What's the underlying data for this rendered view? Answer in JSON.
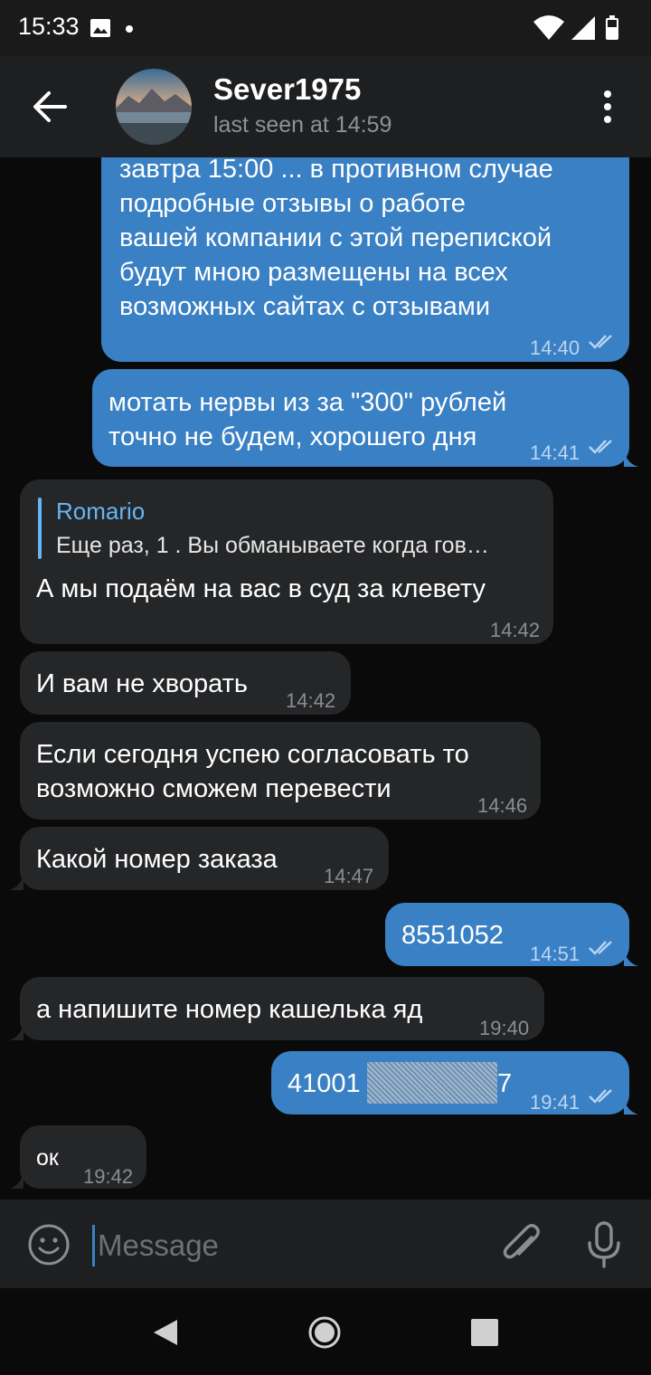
{
  "status_bar": {
    "time": "15:33",
    "icons": [
      "photo-icon",
      "dot-icon",
      "wifi-icon",
      "signal-icon",
      "battery-icon"
    ]
  },
  "header": {
    "title": "Sever1975",
    "subtitle": "last seen at 14:59",
    "icons": [
      "back-arrow-icon",
      "avatar",
      "more-vertical-icon"
    ]
  },
  "messages": [
    {
      "dir": "out",
      "lines": [
        "завтра 15:00 ... в противном случае",
        "подробные отзывы о работе",
        "вашей компании с этой перепиской",
        "будут мною размещены на всех",
        "возможных сайтах с отзывами"
      ],
      "time": "14:40",
      "read": true
    },
    {
      "dir": "out",
      "lines": [
        "мотать нервы из за \"300\" рублей",
        "точно не будем, хорошего дня"
      ],
      "time": "14:41",
      "read": true
    },
    {
      "dir": "in",
      "reply_name": "Romario",
      "reply_text": "Еще раз, 1 . Вы обманываете когда гов…",
      "lines": [
        "А мы подаём на вас в суд за клевету"
      ],
      "time": "14:42"
    },
    {
      "dir": "in",
      "lines": [
        "И вам не хворать"
      ],
      "time": "14:42"
    },
    {
      "dir": "in",
      "lines": [
        "Если сегодня успею согласовать то",
        "возможно сможем перевести"
      ],
      "time": "14:46"
    },
    {
      "dir": "in",
      "lines": [
        "Какой номер заказа"
      ],
      "time": "14:47"
    },
    {
      "dir": "out",
      "lines": [
        "8551052"
      ],
      "time": "14:51",
      "read": true
    },
    {
      "dir": "in",
      "lines": [
        "а напишите номер кашелька яд"
      ],
      "time": "19:40"
    },
    {
      "dir": "out",
      "lines": [
        "41001",
        "7"
      ],
      "time": "19:41",
      "read": true,
      "redacted": true
    },
    {
      "dir": "in",
      "lines": [
        "ок"
      ],
      "time": "19:42"
    }
  ],
  "input": {
    "placeholder": "Message",
    "icons": [
      "emoji-icon",
      "attach-icon",
      "mic-icon"
    ]
  },
  "nav": {
    "icons": [
      "nav-back-icon",
      "nav-home-icon",
      "nav-recents-icon"
    ]
  },
  "colors": {
    "outgoing_bubble": "#3a80c4",
    "incoming_bubble": "#252628",
    "background": "#0a0a0a",
    "header": "#1e1f21",
    "reply_accent": "#64b5f6"
  }
}
